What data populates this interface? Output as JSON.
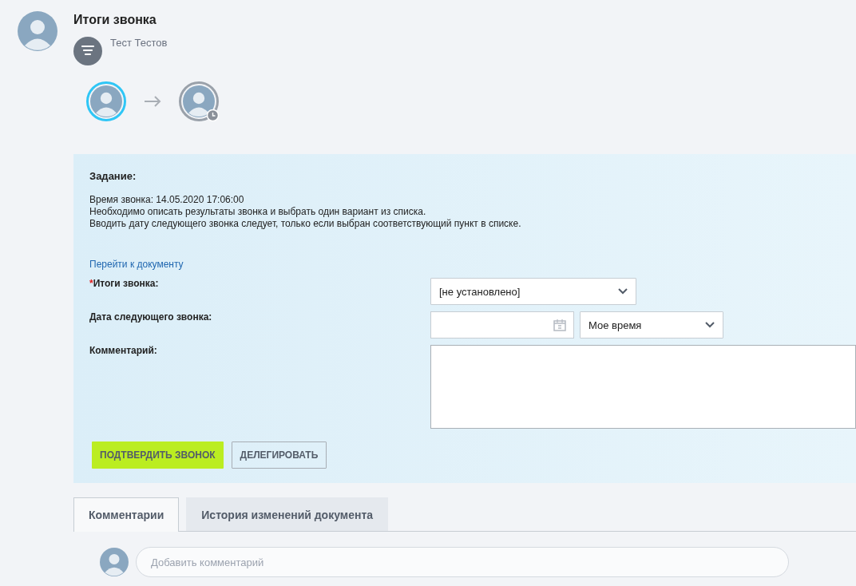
{
  "header": {
    "title": "Итоги звонка",
    "author": "Тест Тестов"
  },
  "flow": [
    {
      "kind": "active"
    },
    {
      "kind": "waiting"
    }
  ],
  "task": {
    "heading": "Задание:",
    "lines": [
      "Время звонка: 14.05.2020 17:06:00",
      "Необходимо описать результаты звонка и выбрать один вариант из списка.",
      "Вводить дату следующего звонка следует, только если выбран соответствующий пункт в списке."
    ],
    "link": "Перейти к документу"
  },
  "required_mark": "*",
  "fields": [
    {
      "kind": "select",
      "label": "Итоги звонка:",
      "required": true,
      "value": "[не установлено]"
    },
    {
      "kind": "datetime",
      "label": "Дата следующего звонка:",
      "required": false,
      "time_value": "Мое время"
    },
    {
      "kind": "textarea",
      "label": "Комментарий:",
      "required": false
    }
  ],
  "buttons": [
    {
      "label": "ПОДТВЕРДИТЬ ЗВОНОК",
      "kind": "primary"
    },
    {
      "label": "ДЕЛЕГИРОВАТЬ",
      "kind": "secondary"
    }
  ],
  "tabs": [
    {
      "label": "Комментарии",
      "selected": true
    },
    {
      "label": "История изменений документа",
      "selected": false
    }
  ],
  "comment": {
    "placeholder": "Добавить комментарий"
  }
}
